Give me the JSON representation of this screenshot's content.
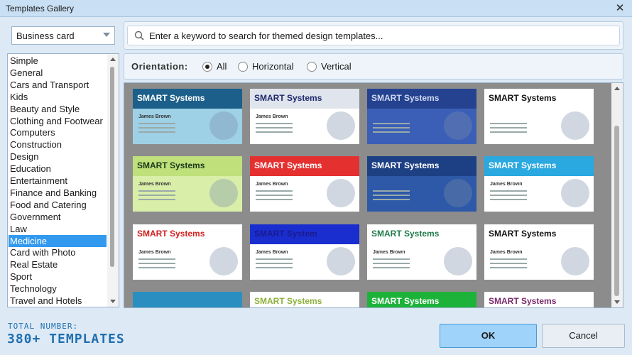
{
  "window": {
    "title": "Templates Gallery",
    "close_glyph": "✕"
  },
  "category_dropdown": {
    "selected": "Business card"
  },
  "search": {
    "placeholder": "Enter a keyword to search for themed design templates..."
  },
  "categories": {
    "items": [
      {
        "label": "Simple"
      },
      {
        "label": "General"
      },
      {
        "label": "Cars and Transport"
      },
      {
        "label": "Kids"
      },
      {
        "label": "Beauty and Style"
      },
      {
        "label": "Clothing and Footwear"
      },
      {
        "label": "Computers"
      },
      {
        "label": "Construction"
      },
      {
        "label": "Design"
      },
      {
        "label": "Education"
      },
      {
        "label": "Entertainment"
      },
      {
        "label": "Finance and Banking"
      },
      {
        "label": "Food and Catering"
      },
      {
        "label": "Government"
      },
      {
        "label": "Law"
      },
      {
        "label": "Medicine",
        "selected": true
      },
      {
        "label": "Card with Photo"
      },
      {
        "label": "Real Estate"
      },
      {
        "label": "Sport"
      },
      {
        "label": "Technology"
      },
      {
        "label": "Travel and Hotels"
      }
    ]
  },
  "orientation": {
    "label": "Orientation:",
    "options": [
      {
        "label": "All",
        "checked": true
      },
      {
        "label": "Horizontal",
        "checked": false
      },
      {
        "label": "Vertical",
        "checked": false
      }
    ]
  },
  "templates": [
    {
      "company": "SMART Systems",
      "name": "James Brown",
      "bg": "#9ed0e6",
      "band": "#1b5f8a",
      "text_color": "#ffffff",
      "icon": "lab-icon"
    },
    {
      "company": "SMART Systems",
      "name": "James Brown",
      "bg": "#ffffff",
      "band": "#e0e4ec",
      "text_color": "#1e2a6e",
      "icon": "dna-icon"
    },
    {
      "company": "SMART Systems",
      "name": "",
      "bg": "#3b5fb6",
      "band": "#24428f",
      "text_color": "#cfd9f5",
      "icon": "stethoscope-icon"
    },
    {
      "company": "SMART Systems",
      "name": "",
      "bg": "#ffffff",
      "band": "#ffffff",
      "text_color": "#111111",
      "icon": "doctors-photo-icon"
    },
    {
      "company": "SMART Systems",
      "name": "James Brown",
      "bg": "#d9eea8",
      "band": "#bfe07a",
      "text_color": "#1b3a1b",
      "icon": "pattern-icon"
    },
    {
      "company": "SMART Systems",
      "name": "James Brown",
      "bg": "#ffffff",
      "band": "#e53030",
      "text_color": "#ffffff",
      "icon": "thermometer-icon"
    },
    {
      "company": "SMART Systems",
      "name": "",
      "bg": "#2e59a8",
      "band": "#1d3f84",
      "text_color": "#ffffff",
      "icon": "tooth-cartoon-icon"
    },
    {
      "company": "SMART Systems",
      "name": "James Brown",
      "bg": "#ffffff",
      "band": "#2aa8e0",
      "text_color": "#ffffff",
      "icon": "stethoscope-icon"
    },
    {
      "company": "SMART Systems",
      "name": "James Brown",
      "bg": "#ffffff",
      "band": "#ffffff",
      "text_color": "#d02020",
      "icon": "red-cross-icon"
    },
    {
      "company": "SMART System",
      "name": "James Brown",
      "bg": "#ffffff",
      "band": "#1a2ed0",
      "text_color": "#1a1a8e",
      "icon": "tooth-icon"
    },
    {
      "company": "SMART Systems",
      "name": "James Brown",
      "bg": "#ffffff",
      "band": "#ffffff",
      "text_color": "#1f7a4a",
      "icon": "pharmacy-icon"
    },
    {
      "company": "SMART Systems",
      "name": "James Brown",
      "bg": "#ffffff",
      "band": "#ffffff",
      "text_color": "#111111",
      "icon": "doctor-coat-icon"
    },
    {
      "company": "",
      "name": "",
      "bg": "#4bb6e0",
      "band": "#2a8fc0",
      "text_color": "#ffffff",
      "icon": "medical-cross-icon"
    },
    {
      "company": "SMART Systems",
      "name": "",
      "bg": "#ffffff",
      "band": "#ffffff",
      "text_color": "#8db03a",
      "icon": "nurse-photo-icon"
    },
    {
      "company": "SMART Systems",
      "name": "",
      "bg": "#1db33a",
      "band": "#1db33a",
      "text_color": "#ffffff",
      "icon": ""
    },
    {
      "company": "SMART Systems",
      "name": "",
      "bg": "#ffffff",
      "band": "#ffffff",
      "text_color": "#7a2a6a",
      "icon": "purple-pattern-icon"
    }
  ],
  "footer": {
    "total_label": "Total number:",
    "total_value": "380+ templates",
    "ok_label": "OK",
    "cancel_label": "Cancel"
  }
}
